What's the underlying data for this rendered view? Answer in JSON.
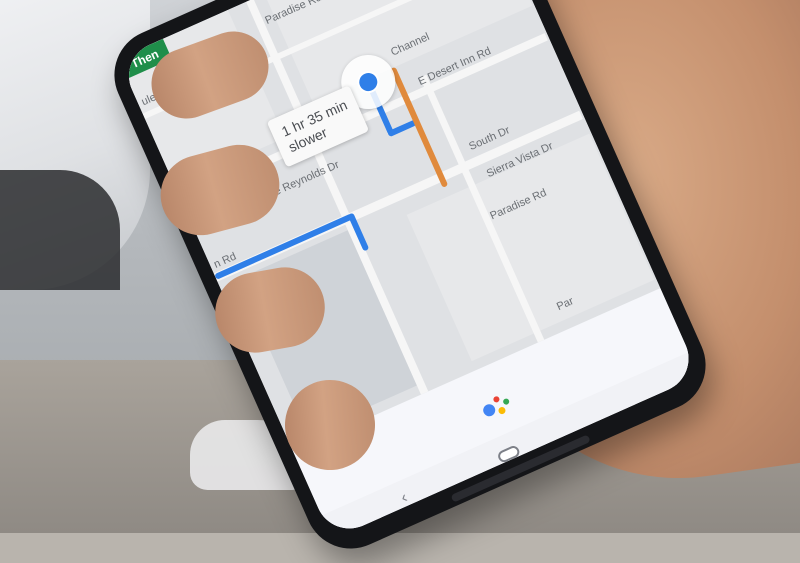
{
  "map": {
    "then_label": "Then",
    "callout_line1": "1 hr 35 min",
    "callout_line2": "slower",
    "roads": {
      "boulevard": "ulevard",
      "paradise_top": "Paradise Rd",
      "debbie_reynolds": "Debbie Reynolds Dr",
      "desert_inn_east": "E Desert Inn Rd",
      "desert_inn_west": "n Rd",
      "south_dr": "South Dr",
      "sierra_vista": "Sierra Vista Dr",
      "paradise_mid": "Paradise Rd",
      "paradise_abbrev": "Par",
      "channel_vertical": "Channel"
    }
  },
  "assistant": {
    "colors": [
      "#4285f4",
      "#ea4335",
      "#fbbc05",
      "#34a853"
    ]
  },
  "navigation": {
    "back_glyph": "‹"
  }
}
